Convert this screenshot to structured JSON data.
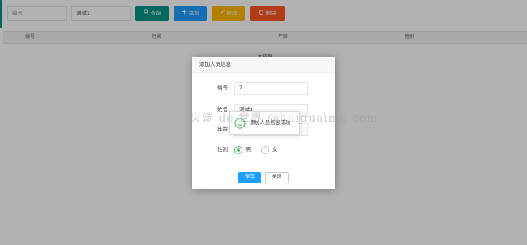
{
  "toolbar": {
    "id_placeholder": "编号",
    "name_value": "测试1",
    "query_label": "查询",
    "add_label": "添加",
    "edit_label": "修改",
    "delete_label": "删除",
    "colors": {
      "query": "#009688",
      "add": "#1e9fff",
      "edit": "#ffb800",
      "delete": "#ff5722"
    }
  },
  "table": {
    "columns": [
      "编号",
      "姓名",
      "年龄",
      "性别"
    ],
    "empty_text": "无数据"
  },
  "dialog": {
    "title": "添加人员信息",
    "fields": {
      "id_label": "编号",
      "id_value": "7",
      "name_label": "姓名",
      "name_value": "测试3",
      "age_label": "年龄",
      "gender_label": "性别",
      "gender_options": [
        "男",
        "女"
      ],
      "gender_selected": "男"
    },
    "save_label": "保存",
    "close_label": "关闭"
  },
  "toast": {
    "message": "添加人员信息成功"
  },
  "watermark": {
    "text": "火端 de 世界 @huiduaima.com"
  }
}
